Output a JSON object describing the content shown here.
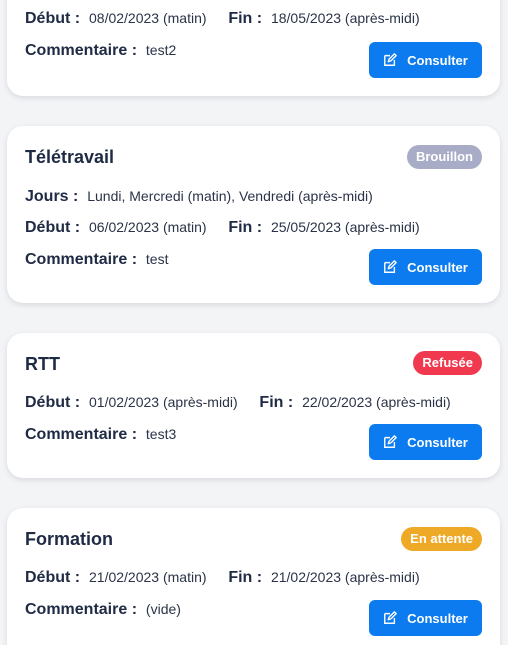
{
  "colors": {
    "draft": "#a9acc6",
    "refused": "#f0384f",
    "pending": "#eea927",
    "primary": "#0b7bef"
  },
  "labels": {
    "start": "Début :",
    "end": "Fin :",
    "comment": "Commentaire :",
    "days": "Jours :",
    "consult": "Consulter"
  },
  "cards": [
    {
      "start": "08/02/2023 (matin)",
      "end": "18/05/2023 (après-midi)",
      "comment": "test2"
    },
    {
      "title": "Télétravail",
      "status": "Brouillon",
      "days": "Lundi, Mercredi (matin), Vendredi (après-midi)",
      "start": "06/02/2023 (matin)",
      "end": "25/05/2023 (après-midi)",
      "comment": "test"
    },
    {
      "title": "RTT",
      "status": "Refusée",
      "start": "01/02/2023 (après-midi)",
      "end": "22/02/2023 (après-midi)",
      "comment": "test3"
    },
    {
      "title": "Formation",
      "status": "En attente",
      "start": "21/02/2023 (matin)",
      "end": "21/02/2023 (après-midi)",
      "comment": "(vide)"
    }
  ]
}
